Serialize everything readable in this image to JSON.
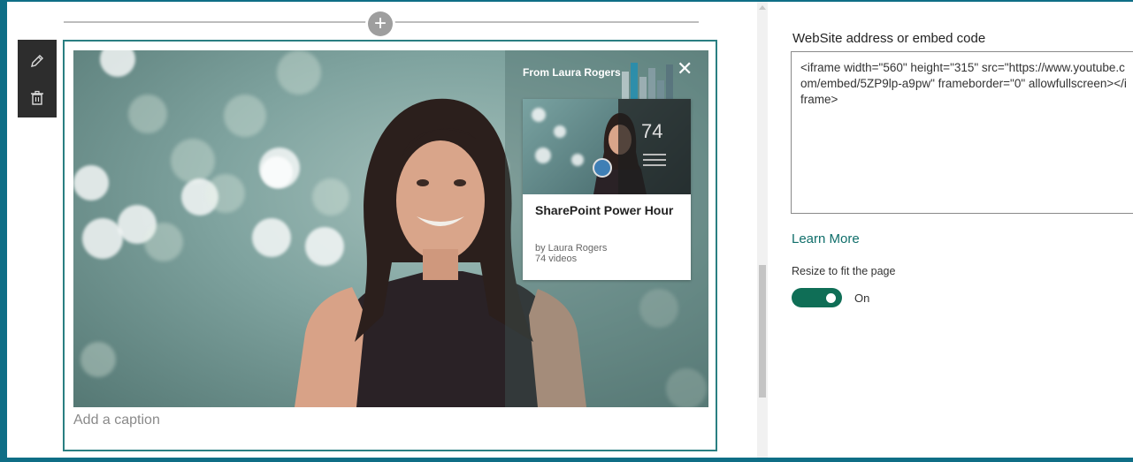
{
  "canvas": {
    "webpart": {
      "video": {
        "overlay_title": "From Laura Rogers",
        "playlist_card": {
          "video_count": "74",
          "title": "SharePoint Power Hour",
          "byline": "by Laura Rogers",
          "videos_label": "74 videos"
        }
      },
      "caption_placeholder": "Add a caption"
    },
    "toolbar": {
      "edit_icon": "pencil-icon",
      "delete_icon": "trash-icon"
    }
  },
  "property_pane": {
    "embed_label": "WebSite address or embed code",
    "embed_code": "<iframe width=\"560\" height=\"315\" src=\"https://www.youtube.com/embed/5ZP9lp-a9pw\" frameborder=\"0\" allowfullscreen></iframe>",
    "learn_more": "Learn More",
    "resize_label": "Resize to fit the page",
    "toggle_state": "On"
  },
  "colors": {
    "accent": "#0f6e56",
    "selection_border": "#2a7f82",
    "background": "#0f6e86"
  }
}
